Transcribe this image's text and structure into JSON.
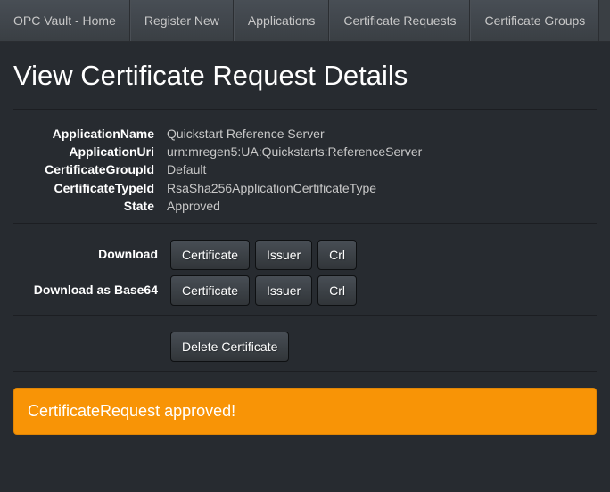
{
  "nav": {
    "items": [
      {
        "label": "OPC Vault - Home"
      },
      {
        "label": "Register New"
      },
      {
        "label": "Applications"
      },
      {
        "label": "Certificate Requests"
      },
      {
        "label": "Certificate Groups"
      }
    ]
  },
  "page": {
    "title": "View Certificate Request Details"
  },
  "details": {
    "applicationName": {
      "label": "ApplicationName",
      "value": "Quickstart Reference Server"
    },
    "applicationUri": {
      "label": "ApplicationUri",
      "value": "urn:mregen5:UA:Quickstarts:ReferenceServer"
    },
    "certificateGroupId": {
      "label": "CertificateGroupId",
      "value": "Default"
    },
    "certificateTypeId": {
      "label": "CertificateTypeId",
      "value": "RsaSha256ApplicationCertificateType"
    },
    "state": {
      "label": "State",
      "value": "Approved"
    }
  },
  "downloads": {
    "download": {
      "label": "Download",
      "certificate": "Certificate",
      "issuer": "Issuer",
      "crl": "Crl"
    },
    "downloadBase64": {
      "label": "Download as Base64",
      "certificate": "Certificate",
      "issuer": "Issuer",
      "crl": "Crl"
    }
  },
  "actions": {
    "delete": "Delete Certificate"
  },
  "alert": {
    "message": "CertificateRequest approved!"
  }
}
